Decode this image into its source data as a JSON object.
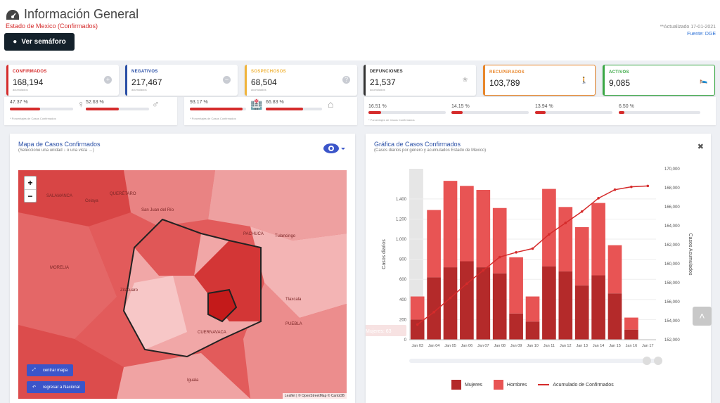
{
  "header": {
    "title": "Información General",
    "subtitle": "Estado de Mexico (Confirmados)",
    "semaforo_button": "Ver semáforo",
    "updated": "**Actualizado 17-01-2021",
    "source": "Fuente: DGE"
  },
  "cards": [
    {
      "label": "CONFIRMADOS",
      "value": "168,194",
      "sub": "acumulados",
      "color": "#d52b2b",
      "icon": "plus-circle-icon"
    },
    {
      "label": "NEGATIVOS",
      "value": "217,467",
      "sub": "acumulados",
      "color": "#2a4fa6",
      "icon": "minus-circle-icon"
    },
    {
      "label": "SOSPECHOSOS",
      "value": "68,504",
      "sub": "acumulados",
      "color": "#f0b43c",
      "icon": "question-circle-icon"
    },
    {
      "label": "DEFUNCIONES",
      "value": "21,537",
      "sub": "acumulados",
      "color": "#333333",
      "icon": "ribbon-icon"
    },
    {
      "label": "RECUPERADOS",
      "value": "103,789",
      "sub": "",
      "color": "#e8862a",
      "icon": "walking-icon"
    },
    {
      "label": "ACTIVOS",
      "value": "9,085",
      "sub": "",
      "color": "#3aa845",
      "icon": "bed-icon"
    }
  ],
  "strips": {
    "gender": {
      "women": "47.37 %",
      "men": "52.63 %",
      "women_pct": 47.37,
      "men_pct": 52.63,
      "note": "* Porcentajes de Casos Confirmados"
    },
    "care": {
      "left": "93.17 %",
      "right": "66.83 %",
      "left_pct": 93.17,
      "right_pct": 66.83,
      "note": "* Porcentajes de Casos Confirmados"
    },
    "comorb": {
      "items": [
        "16.51 %",
        "14.15 %",
        "13.94 %",
        "6.50 %"
      ],
      "pcts": [
        16.51,
        14.15,
        13.94,
        6.5
      ],
      "note": "* Porcentajes de Casos Confirmados"
    }
  },
  "map_panel": {
    "title": "Mapa de Casos Confirmados",
    "subtitle": "(Seleccione una unidad ↓ o una vista →)",
    "zoom_in": "+",
    "zoom_out": "−",
    "center_button": "centrar mapa",
    "national_button": "regresar a Nacional",
    "attribution": "Leaflet | © OpenStreetMap © CartoDB",
    "places": [
      "QUERÉTARO",
      "SALAMANCA",
      "MORELIA",
      "PACHUCA",
      "Tlaxcala",
      "PUEBLA",
      "CUERNAVACA",
      "Celaya",
      "San Juan del Río",
      "Tulancingo",
      "Zitácuaro",
      "Iguala"
    ]
  },
  "chart_panel": {
    "title": "Gráfica de Casos Confirmados",
    "subtitle": "(Casos diarios por género y acumulados Estado de Mexico)",
    "tooltip": "Mujeres: 63"
  },
  "chart_data": {
    "type": "bar",
    "categories": [
      "Jan 03",
      "Jan 04",
      "Jan 05",
      "Jan 06",
      "Jan 07",
      "Jan 08",
      "Jan 09",
      "Jan 10",
      "Jan 11",
      "Jan 12",
      "Jan 13",
      "Jan 14",
      "Jan 15",
      "Jan 16",
      "Jan 17"
    ],
    "series": [
      {
        "name": "Mujeres",
        "values": [
          200,
          620,
          720,
          780,
          720,
          660,
          260,
          180,
          730,
          680,
          540,
          640,
          460,
          100,
          0
        ],
        "color": "#b42a2a"
      },
      {
        "name": "Hombres",
        "values": [
          230,
          670,
          860,
          750,
          770,
          650,
          560,
          250,
          770,
          640,
          580,
          720,
          480,
          120,
          0
        ],
        "color": "#e85454"
      },
      {
        "name": "Acumulado de Confirmados",
        "values": [
          153600,
          154900,
          156400,
          157900,
          159300,
          160700,
          161200,
          161600,
          163100,
          164300,
          165500,
          166900,
          167800,
          168100,
          168194
        ],
        "color": "#d52b2b"
      }
    ],
    "ylabel": "Casos diarios",
    "ylabel_right": "Casos Acumulados",
    "ylim": [
      0,
      1700
    ],
    "ylim_right": [
      152000,
      170000
    ],
    "yticks": [
      "0",
      "200",
      "400",
      "600",
      "800",
      "1,000",
      "1,200",
      "1,400"
    ],
    "yticks_right": [
      "152,000",
      "154,000",
      "156,000",
      "158,000",
      "160,000",
      "162,000",
      "164,000",
      "166,000",
      "168,000",
      "170,000"
    ]
  }
}
